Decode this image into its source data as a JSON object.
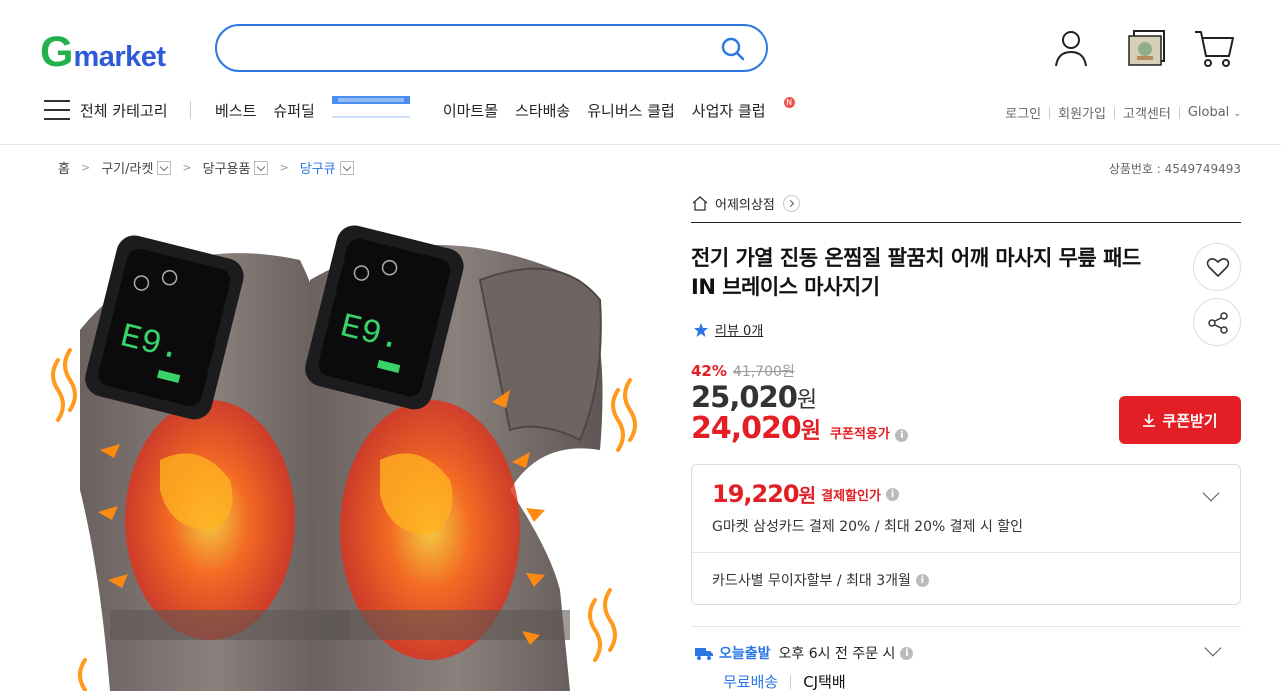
{
  "header": {
    "logo_g": "G",
    "logo_rest": "market",
    "search": {
      "value": "",
      "placeholder": ""
    },
    "icons": [
      "user-icon",
      "recent-view-icon",
      "cart-icon"
    ]
  },
  "nav": {
    "all_categories": "전체 카테고리",
    "items": [
      "베스트",
      "슈퍼딜"
    ],
    "items2": [
      "이마트몰",
      "스타배송",
      "유니버스 클럽",
      "사업자 클럽"
    ],
    "badge": "N",
    "util": [
      "로그인",
      "회원가입",
      "고객센터",
      "Global"
    ]
  },
  "breadcrumb": {
    "home": "홈",
    "items": [
      "구기/라켓",
      "당구용품",
      "당구큐"
    ]
  },
  "product_no": "상품번호 : 4549749493",
  "product": {
    "shop": "어제의상점",
    "title": "전기 가열 진동 온찜질 팔꿈치 어깨 마사지 무릎 패드 IN 브레이스 마사지기",
    "review": "리뷰 0개",
    "discount_pct": "42%",
    "original_price": "41,700원",
    "price_num": "25,020",
    "price_unit": "원",
    "coupon_price_num": "24,020",
    "coupon_price_unit": "원",
    "coupon_price_label": "쿠폰적용가",
    "coupon_button": "쿠폰받기"
  },
  "payment": {
    "price_num": "19,220",
    "price_unit": "원",
    "label": "결제할인가",
    "desc": "G마켓 삼성카드 결제 20% / 최대 20% 결제 시 할인",
    "installment": "카드사별 무이자할부 / 최대 3개월"
  },
  "shipping": {
    "badge": "오늘출발",
    "time": "오후 6시 전 주문 시",
    "free": "무료배송",
    "carrier": "CJ택배"
  },
  "colors": {
    "brand_green": "#24b04a",
    "brand_blue": "#2d5bd7",
    "accent_red": "#e31e24",
    "link_blue": "#2b77e4"
  }
}
